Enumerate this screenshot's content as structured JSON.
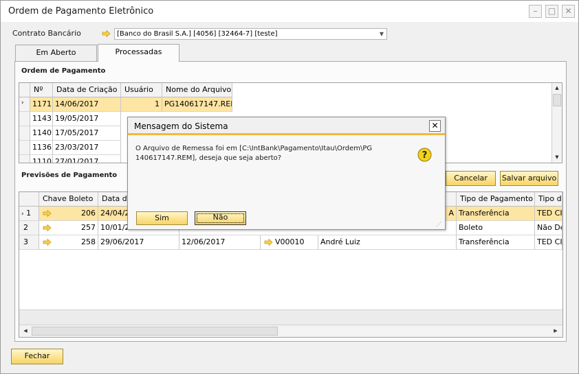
{
  "window": {
    "title": "Ordem de Pagamento Eletrônico"
  },
  "contract": {
    "label": "Contrato Bancário",
    "value": "[Banco do Brasil S.A.] [4056] [32464-7] [teste]"
  },
  "tabs": [
    {
      "label": "Em Aberto"
    },
    {
      "label": "Processadas"
    }
  ],
  "orders": {
    "title": "Ordem de Pagamento",
    "columns": [
      "Nº",
      "Data de Criação",
      "Usuário",
      "Nome do Arquivo"
    ],
    "rows": [
      {
        "n": "1171",
        "date": "14/06/2017",
        "user": "1",
        "file": "PG140617147.REM"
      },
      {
        "n": "1143",
        "date": "19/05/2017",
        "user": "",
        "file": ""
      },
      {
        "n": "1140",
        "date": "17/05/2017",
        "user": "",
        "file": ""
      },
      {
        "n": "1136",
        "date": "23/03/2017",
        "user": "",
        "file": ""
      },
      {
        "n": "1110",
        "date": "27/01/2017",
        "user": "",
        "file": ""
      }
    ]
  },
  "forecasts": {
    "title": "Previsões de Pagamento",
    "columns": [
      "Chave Boleto",
      "Data de",
      "Tipo de Pagamento",
      "Tipo de"
    ],
    "rows": [
      {
        "idx": "1",
        "key": "206",
        "date": "24/04/2",
        "extra": "A",
        "type": "Transferência",
        "type2": "TED CIP"
      },
      {
        "idx": "2",
        "key": "257",
        "date": "10/01/2",
        "extra": "",
        "type": "Boleto",
        "type2": "Não Def"
      },
      {
        "idx": "3",
        "key": "258",
        "date": "29/06/2017",
        "date2": "12/06/2017",
        "code": "V00010",
        "name": "André Luiz",
        "type": "Transferência",
        "type2": "TED CIP"
      }
    ]
  },
  "buttons": {
    "cancel": "Cancelar",
    "save": "Salvar arquivo",
    "close": "Fechar"
  },
  "dialog": {
    "title": "Mensagem do Sistema",
    "message": "O Arquivo de Remessa foi em [C:\\IntBank\\Pagamento\\Itau\\Ordem\\PG 140617147.REM], deseja que seja aberto?",
    "yes": "Sim",
    "no": "Não"
  },
  "colors": {
    "accent": "#f5b936",
    "selected_row": "#fde5a3",
    "button": "#f7d466"
  }
}
